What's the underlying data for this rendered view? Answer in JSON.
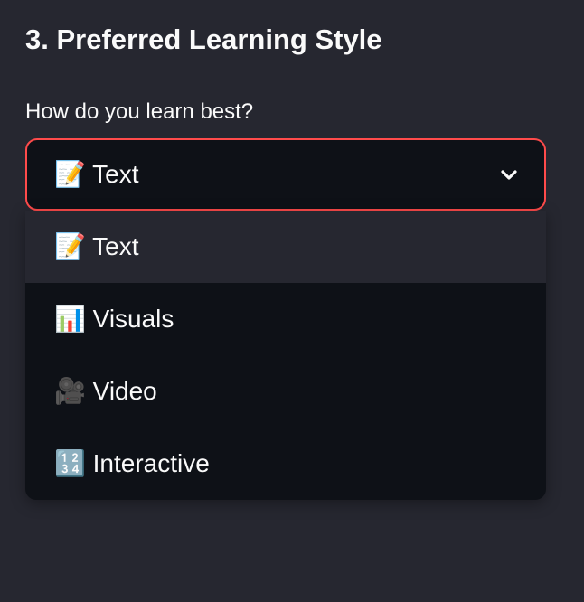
{
  "section": {
    "title": "3. Preferred Learning Style"
  },
  "question": {
    "label": "How do you learn best?"
  },
  "select": {
    "selected_value": "📝 Text",
    "options": [
      "📝 Text",
      "📊 Visuals",
      "🎥 Video",
      "🔢 Interactive"
    ],
    "highlighted_index": 0
  },
  "icons": {
    "dropdown_toggle": "chevron-down-icon"
  },
  "colors": {
    "page_background": "#262730",
    "input_background": "#0e1117",
    "focus_border": "#ff4b4b",
    "highlighted_option": "#262730",
    "text": "#fafafa"
  }
}
